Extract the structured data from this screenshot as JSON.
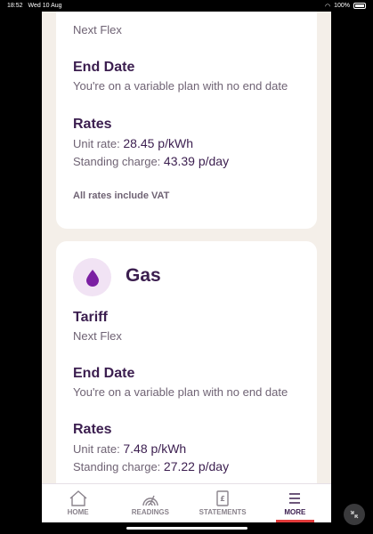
{
  "status": {
    "time": "18:52",
    "date": "Wed 10 Aug",
    "battery": "100%"
  },
  "electric": {
    "tariff_value": "Next Flex",
    "end_date_title": "End Date",
    "end_date_value": "You're on a variable plan with no end date",
    "rates_title": "Rates",
    "unit_rate_label": "Unit rate:",
    "unit_rate_value": "28.45 p/kWh",
    "standing_label": "Standing charge:",
    "standing_value": "43.39 p/day",
    "vat_note": "All rates include VAT"
  },
  "gas": {
    "title": "Gas",
    "tariff_title": "Tariff",
    "tariff_value": "Next Flex",
    "end_date_title": "End Date",
    "end_date_value": "You're on a variable plan with no end date",
    "rates_title": "Rates",
    "unit_rate_label": "Unit rate:",
    "unit_rate_value": "7.48 p/kWh",
    "standing_label": "Standing charge:",
    "standing_value": "27.22 p/day"
  },
  "tabs": [
    {
      "label": "HOME",
      "icon": "home-icon"
    },
    {
      "label": "READINGS",
      "icon": "readings-icon"
    },
    {
      "label": "STATEMENTS",
      "icon": "statements-icon"
    },
    {
      "label": "MORE",
      "icon": "menu-icon"
    }
  ],
  "colors": {
    "accent": "#3b1e4f",
    "active_indicator": "#e23a3a",
    "gas_icon": "#7b1fa2"
  }
}
